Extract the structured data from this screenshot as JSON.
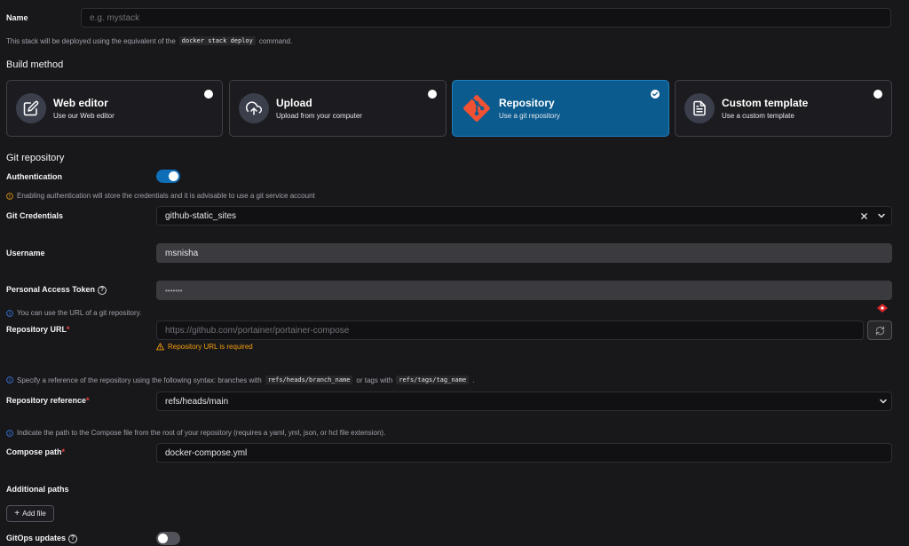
{
  "name_field": {
    "label": "Name",
    "placeholder": "e.g. mystack",
    "hint_before": "This stack will be deployed using the equivalent of the",
    "hint_code": "docker stack deploy",
    "hint_after": "command."
  },
  "build_method": {
    "title": "Build method",
    "options": [
      {
        "title": "Web editor",
        "desc": "Use our Web editor",
        "icon": "edit-icon",
        "selected": false
      },
      {
        "title": "Upload",
        "desc": "Upload from your computer",
        "icon": "upload-icon",
        "selected": false
      },
      {
        "title": "Repository",
        "desc": "Use a git repository",
        "icon": "git-icon",
        "selected": true
      },
      {
        "title": "Custom template",
        "desc": "Use a custom template",
        "icon": "file-text-icon",
        "selected": false
      }
    ]
  },
  "git": {
    "title": "Git repository",
    "authentication_label": "Authentication",
    "authentication_on": true,
    "auth_warning": "Enabling authentication will store the credentials and it is advisable to use a git service account",
    "credentials_label": "Git Credentials",
    "credentials_value": "github-static_sites",
    "username_label": "Username",
    "username_value": "msnisha",
    "token_label": "Personal Access Token",
    "token_value": "•••••••",
    "url_hint": "You can use the URL of a git repository.",
    "url_label": "Repository URL",
    "url_placeholder": "https://github.com/portainer/portainer-compose",
    "url_error": "Repository URL is required",
    "ref_hint_before": "Specify a reference of the repository using the following syntax: branches with",
    "ref_hint_code1": "refs/heads/branch_name",
    "ref_hint_mid": "or tags with",
    "ref_hint_code2": "refs/tags/tag_name",
    "ref_hint_after": ".",
    "ref_label": "Repository reference",
    "ref_value": "refs/heads/main",
    "compose_hint": "Indicate the path to the Compose file from the root of your repository (requires a yaml, yml, json, or hcl file extension).",
    "compose_label": "Compose path",
    "compose_value": "docker-compose.yml",
    "additional_paths_label": "Additional paths",
    "add_file_label": "Add file",
    "gitops_label": "GitOps updates",
    "gitops_on": false
  },
  "colors": {
    "accent": "#0b5b8f",
    "toggle_on": "#0e6fb8",
    "warning": "#f59e0b",
    "info": "#3b82f6",
    "required": "#ef4444"
  }
}
